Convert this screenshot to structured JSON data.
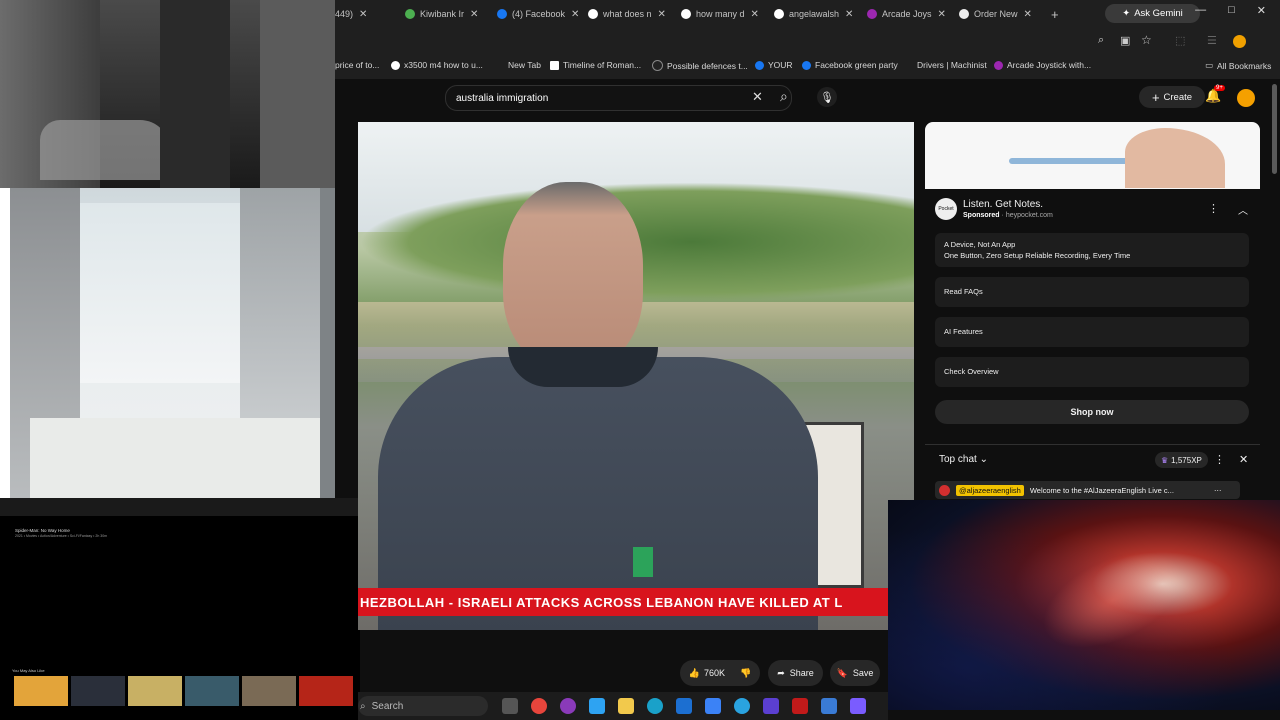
{
  "browser": {
    "tabs": [
      {
        "label": "449)",
        "fav": "#444"
      },
      {
        "label": "Kiwibank Ir",
        "fav": "#4caf50"
      },
      {
        "label": "(4) Facebook",
        "fav": "#1877f2"
      },
      {
        "label": "what does n",
        "fav": "#fff"
      },
      {
        "label": "how many d",
        "fav": "#fff"
      },
      {
        "label": "angelawalsh",
        "fav": "#fff"
      },
      {
        "label": "Arcade Joys",
        "fav": "#9c27b0"
      },
      {
        "label": "Order New",
        "fav": "#eee"
      }
    ],
    "new_tab": "+",
    "gemini_label": "Ask Gemini",
    "window_controls": [
      "—",
      "□",
      "✕"
    ],
    "bookmarks": [
      {
        "label": "price of to...",
        "fav": ""
      },
      {
        "label": "x3500 m4 how to u...",
        "fav": "#fff"
      },
      {
        "label": "New Tab",
        "fav": ""
      },
      {
        "label": "Timeline of Roman...",
        "fav": "#fff"
      },
      {
        "label": "Possible defences t...",
        "fav": "#222"
      },
      {
        "label": "YOUR",
        "fav": "#1877f2"
      },
      {
        "label": "Facebook green party",
        "fav": "#1877f2"
      },
      {
        "label": "Drivers | Machinist",
        "fav": ""
      },
      {
        "label": "Arcade Joystick with...",
        "fav": "#9c27b0"
      }
    ],
    "all_bookmarks": "All Bookmarks"
  },
  "youtube": {
    "search_value": "australia immigration",
    "create_label": "Create",
    "notification_count": "9+"
  },
  "video": {
    "ticker_text": "HEZBOLLAH  -  ISRAELI ATTACKS ACROSS LEBANON HAVE KILLED AT L",
    "likes": "760K",
    "share_label": "Share",
    "save_label": "Save"
  },
  "ad": {
    "title": "Listen. Get Notes.",
    "sponsored": "Sponsored",
    "domain": "heypocket.com",
    "logo_text": "Pocket",
    "rows": [
      {
        "title": "A Device, Not An App",
        "subtitle": "One Button, Zero Setup Reliable Recording, Every Time"
      },
      {
        "title": "Read FAQs",
        "subtitle": ""
      },
      {
        "title": "AI Features",
        "subtitle": ""
      },
      {
        "title": "Check Overview",
        "subtitle": ""
      }
    ],
    "cta": "Shop now"
  },
  "chat": {
    "title": "Top chat",
    "xp": "1,575XP",
    "pinned_author": "@aljazeeraenglish",
    "pinned_message": "Welcome to the #AlJazeeraEnglish Live c..."
  },
  "streaming": {
    "title": "Spider-Man: No Way Home",
    "meta": "2021 • Movies • Action/Adventure • Sci-Fi/Fantasy • 2h 30m",
    "row_label": "You May Also Like"
  },
  "taskbar": {
    "search_placeholder": "Search"
  }
}
